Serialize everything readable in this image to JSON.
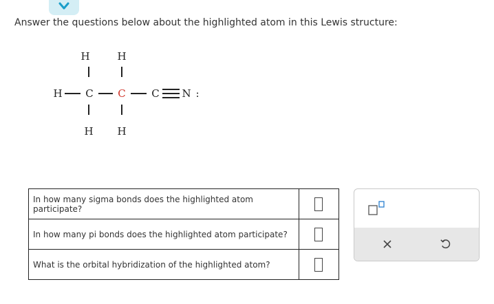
{
  "prompt": "Answer the questions below about the highlighted atom in this Lewis structure:",
  "structure": {
    "atoms": {
      "h_top_left": "H",
      "h_top_right": "H",
      "h_left": "H",
      "c_left": "C",
      "c_highlighted": "C",
      "c_right": "C",
      "n": "N",
      "n_lone_pair": ":",
      "h_bottom_left": "H",
      "h_bottom_right": "H"
    },
    "highlight_color": "#d0352a"
  },
  "questions": [
    {
      "text": "In how many sigma bonds does the highlighted atom participate?",
      "answer": ""
    },
    {
      "text": "In how many pi bonds does the highlighted atom participate?",
      "answer": ""
    },
    {
      "text": "What is the orbital hybridization of the highlighted atom?",
      "answer": ""
    }
  ],
  "panel": {
    "superscript_icon": "superscript-box-icon",
    "clear_icon": "x-icon",
    "undo_icon": "undo-icon"
  },
  "colors": {
    "tab_bg": "#d4eef5",
    "tab_chevron": "#1a9ec9",
    "panel_bar": "#e7e7e7",
    "superscript_accent": "#2a7fcf"
  }
}
